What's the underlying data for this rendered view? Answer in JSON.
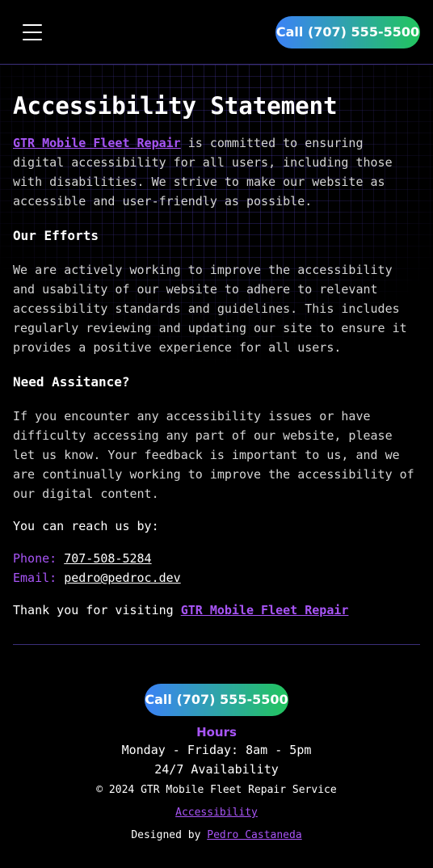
{
  "header": {
    "call_label": "Call (707) 555-5500"
  },
  "main": {
    "title": "Accessibility Statement",
    "intro_link": "GTR Mobile Fleet Repair",
    "intro_text": " is committed to ensuring digital accessibility for all users, including those with disabilities. We strive to make our website as accessible and user-friendly as possible.",
    "efforts_heading": "Our Efforts",
    "efforts_text": "We are actively working to improve the accessibility and usability of our website to adhere to relevant accessibility standards and guidelines. This includes regularly reviewing and updating our site to ensure it provides a positive experience for all users.",
    "help_heading": "Need Assitance?",
    "help_text": "If you encounter any accessibility issues or have difficulty accessing any part of our website, please let us know. Your feedback is important to us, and we are continually working to improve the accessibility of our digital content.",
    "reach_text": "You can reach us by:",
    "phone_label": "Phone: ",
    "phone_value": "707-508-5284",
    "email_label": "Email: ",
    "email_value": "pedro@pedroc.dev",
    "thanks_text": "Thank you for visiting ",
    "thanks_link": "GTR Mobile Fleet Repair"
  },
  "footer": {
    "call_label": "Call (707) 555-5500",
    "hours_title": "Hours",
    "hours_line1": "Monday - Friday: 8am - 5pm",
    "hours_line2": "24/7 Availability",
    "copyright": "© 2024 GTR Mobile Fleet Repair Service",
    "accessibility_link": "Accessibility",
    "designed_by": "Designed by ",
    "designer_link": "Pedro Castaneda"
  },
  "colors": {
    "accent": "#a855f7",
    "gradient_start": "#3b82f6",
    "gradient_end": "#22c55e",
    "background": "#000000"
  }
}
